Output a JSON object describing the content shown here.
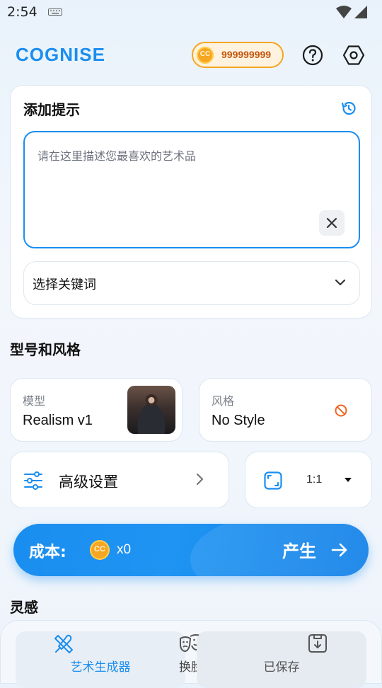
{
  "status_bar": {
    "time": "2:54"
  },
  "header": {
    "logo": "COGNISE",
    "coin_badge": "CC",
    "coin_balance": "999999999"
  },
  "prompt": {
    "title": "添加提示",
    "placeholder": "请在这里描述您最喜欢的艺术品",
    "value": "",
    "keyword_select": "选择关键词"
  },
  "model_style": {
    "section_title": "型号和风格",
    "model_label": "模型",
    "model_value": "Realism v1",
    "style_label": "风格",
    "style_value": "No Style"
  },
  "advanced": {
    "label": "高级设置"
  },
  "aspect_ratio": {
    "value": "1:1"
  },
  "generate": {
    "cost_label": "成本:",
    "coin_badge": "CC",
    "cost_value": "x0",
    "label": "产生"
  },
  "inspiration": {
    "title": "灵感"
  },
  "bottom_tabs": [
    {
      "label": "艺术生成器",
      "icon": "brush-ruler-icon",
      "active": true
    },
    {
      "label": "换脸",
      "icon": "masks-icon",
      "active": false
    },
    {
      "label": "已保存",
      "icon": "saved-download-icon",
      "active": false
    }
  ],
  "colors": {
    "accent": "#1a8ef0",
    "coin": "#f5a623",
    "warning": "#f26522"
  }
}
